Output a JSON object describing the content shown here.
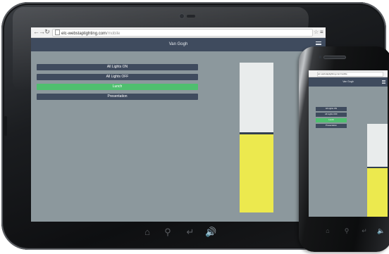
{
  "tablet": {
    "browser": {
      "back_icon": "arrow-left-icon",
      "forward_icon": "arrow-right-icon",
      "reload_icon": "reload-icon",
      "url_host": "elc-webstaplighting.com",
      "url_path": "/mobile",
      "star_icon": "star-icon",
      "menu_icon": "menu-icon"
    },
    "app": {
      "title": "Van Gogh",
      "menu_icon": "hamburger-icon",
      "scenes": [
        {
          "label": "All Lights ON",
          "active": false
        },
        {
          "label": "All Lights OFF",
          "active": false
        },
        {
          "label": "Lunch",
          "active": true
        },
        {
          "label": "Presentation",
          "active": false
        }
      ],
      "level_fraction": 0.52
    },
    "soft_keys": [
      "home-icon",
      "search-icon",
      "back-icon",
      "volume-icon"
    ]
  },
  "phone": {
    "browser": {
      "url": "elc-webstaplighting.com/mobile"
    },
    "app": {
      "title": "Van Gogh",
      "scenes": [
        {
          "label": "All Lights ON",
          "active": false
        },
        {
          "label": "All Lights OFF",
          "active": false
        },
        {
          "label": "Lunch",
          "active": true
        },
        {
          "label": "Presentation",
          "active": false
        }
      ],
      "level_fraction": 0.52
    },
    "soft_keys": [
      "home-icon",
      "search-icon",
      "back-icon",
      "volume-icon"
    ]
  },
  "colors": {
    "header": "#3f4b5e",
    "active_scene": "#4fbf6f",
    "screen_bg": "#8c989d",
    "level_fill": "#ece94e"
  }
}
